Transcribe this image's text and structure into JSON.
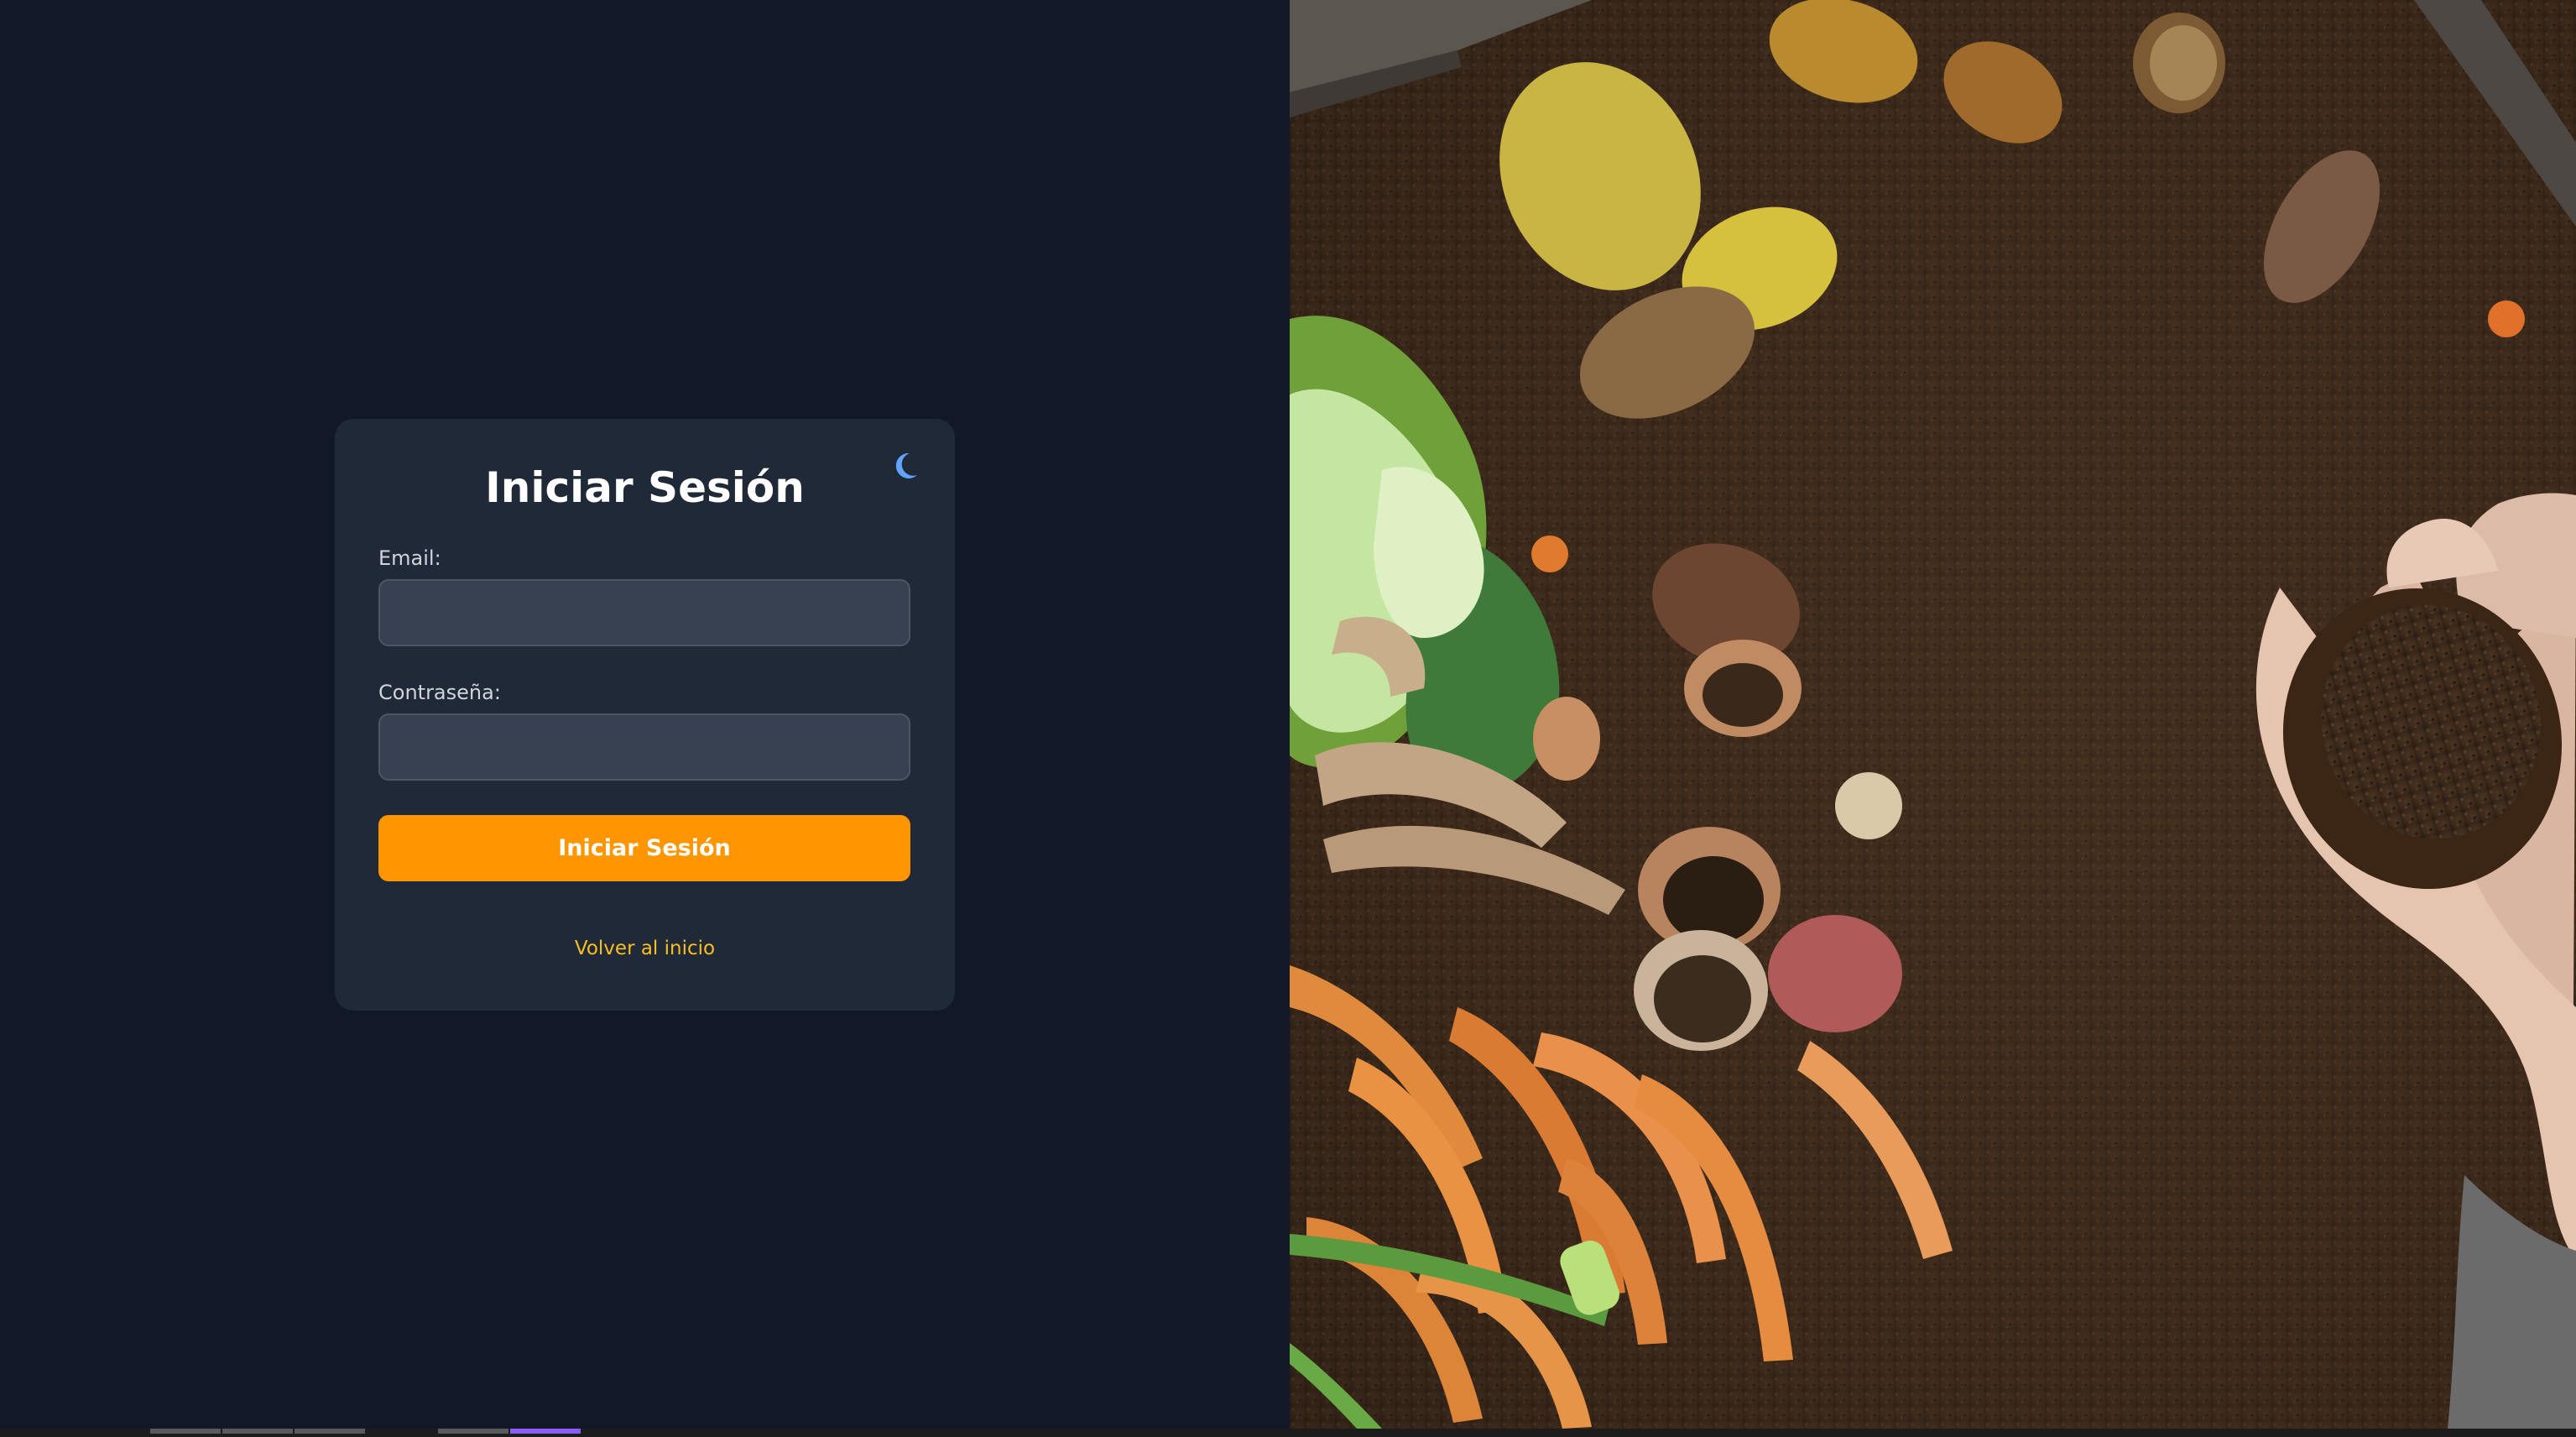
{
  "login": {
    "title": "Iniciar Sesión",
    "email_label": "Email:",
    "email_value": "",
    "password_label": "Contraseña:",
    "password_value": "",
    "submit_label": "Iniciar Sesión",
    "back_link": "Volver al inicio",
    "theme_toggle_icon": "moon-icon"
  },
  "hero_image": {
    "subject": "hands-holding-compost-photo"
  },
  "colors": {
    "background": "#111827",
    "card": "#1f2937",
    "input": "#374151",
    "accent": "#ff9500",
    "link": "#fbbf24",
    "moon": "#60a5fa"
  }
}
